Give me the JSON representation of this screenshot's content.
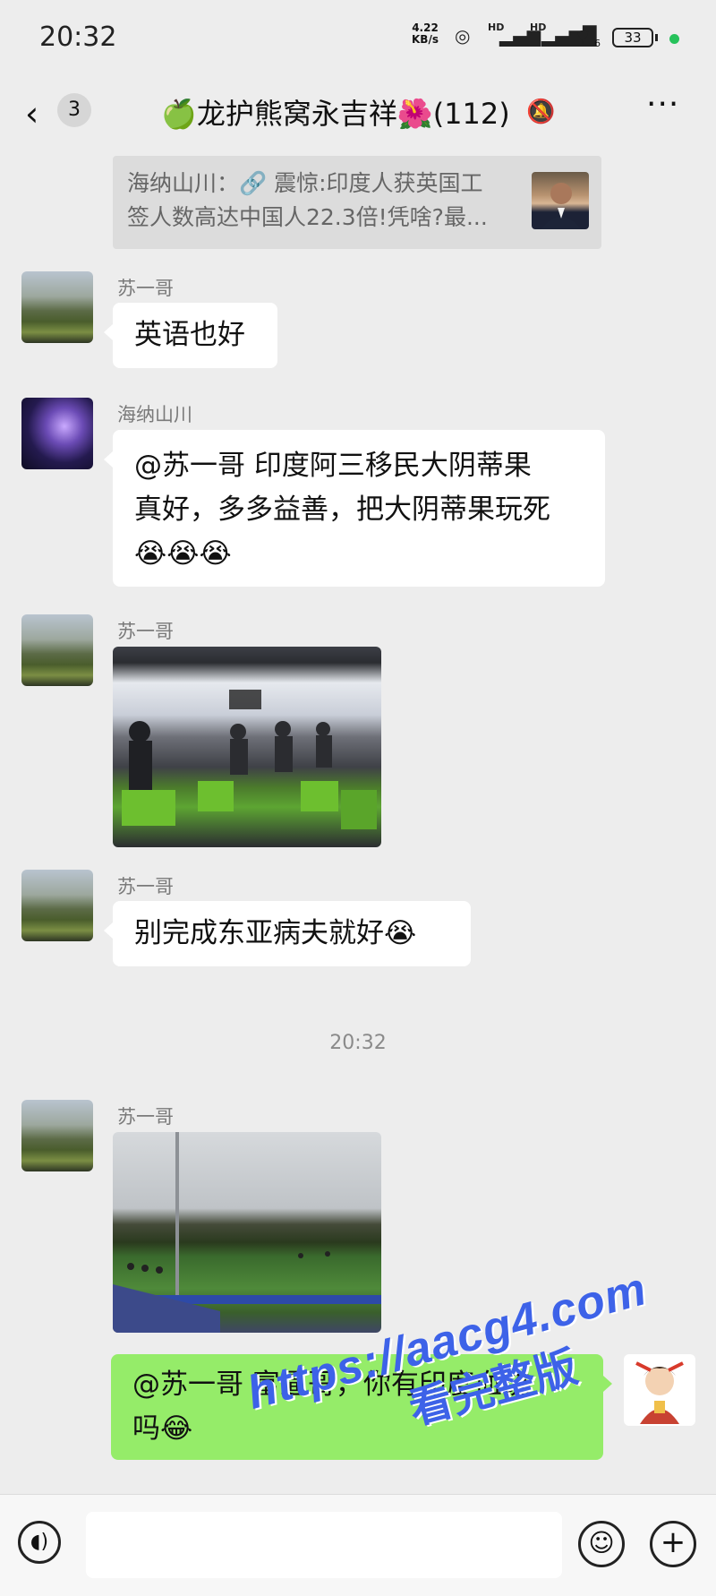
{
  "status_bar": {
    "time": "20:32",
    "net_speed_value": "4.22",
    "net_speed_unit": "KB/s",
    "hd_label_1": "HD",
    "hd_label_2": "HD",
    "wifi_badge": "6",
    "battery": "33"
  },
  "header": {
    "unread_count": "3",
    "title": "🍏龙护熊窝永吉祥🌺(112)",
    "icons": {
      "back": "chevron-left-icon",
      "mute": "bell-muted-icon",
      "more": "more-icon"
    }
  },
  "quote": {
    "line1": "海纳山川：🔗 震惊:印度人获英国工",
    "line2": "签人数高达中国人22.3倍!凭啥?最..."
  },
  "messages": [
    {
      "sender": "苏一哥",
      "text": "英语也好"
    },
    {
      "sender": "海纳山川",
      "lines": [
        "@苏一哥  印度阿三移民大阴蒂果",
        "真好，多多益善，把大阴蒂果玩死",
        "😭😭😭"
      ]
    },
    {
      "sender": "苏一哥"
    },
    {
      "sender": "苏一哥",
      "text": "别完成东亚病夫就好😭"
    },
    {
      "time": "20:32"
    },
    {
      "sender": "苏一哥"
    },
    {
      "lines": [
        "@苏一哥  富逼哥，你有印度血统",
        "吗😂"
      ]
    }
  ],
  "watermark": {
    "url": "https://aacg4.com",
    "subtitle": "看完整版"
  },
  "bottom_bar": {
    "icons": {
      "voice": "voice-icon",
      "emoji": "emoji-icon",
      "plus": "plus-icon"
    }
  },
  "colors": {
    "background": "#ededed",
    "outgoing_bubble": "#95ec69",
    "watermark": "#3d62e8"
  }
}
